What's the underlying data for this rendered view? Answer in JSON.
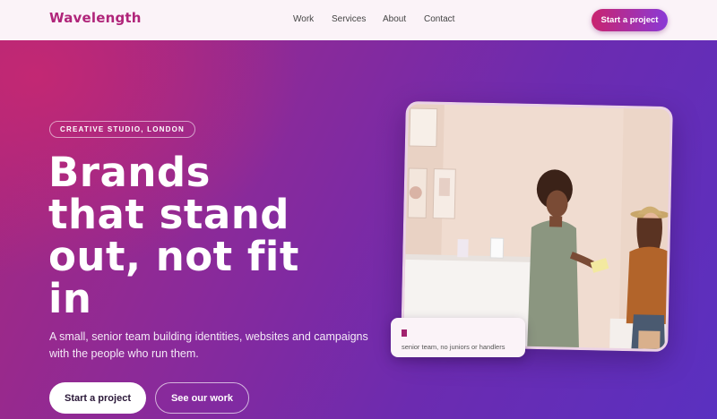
{
  "header": {
    "logo": "Wavelength",
    "nav": [
      "Work",
      "Services",
      "About",
      "Contact"
    ],
    "cta_label": "Start a project"
  },
  "hero": {
    "badge": "CREATIVE STUDIO, LONDON",
    "headline": [
      "Brands",
      "that stand",
      "out, not fit",
      "in"
    ],
    "subtitle": "A small, senior team building identities, websites and campaigns with the people who run them.",
    "primary_button": "Start a project",
    "secondary_button": "See our work",
    "caption": "senior team, no juniors or handlers"
  },
  "colors": {
    "brand": "#b0257a",
    "gradient_start": "#a8287e",
    "gradient_end": "#5a30c0",
    "header_bg": "#fbf3f8"
  }
}
